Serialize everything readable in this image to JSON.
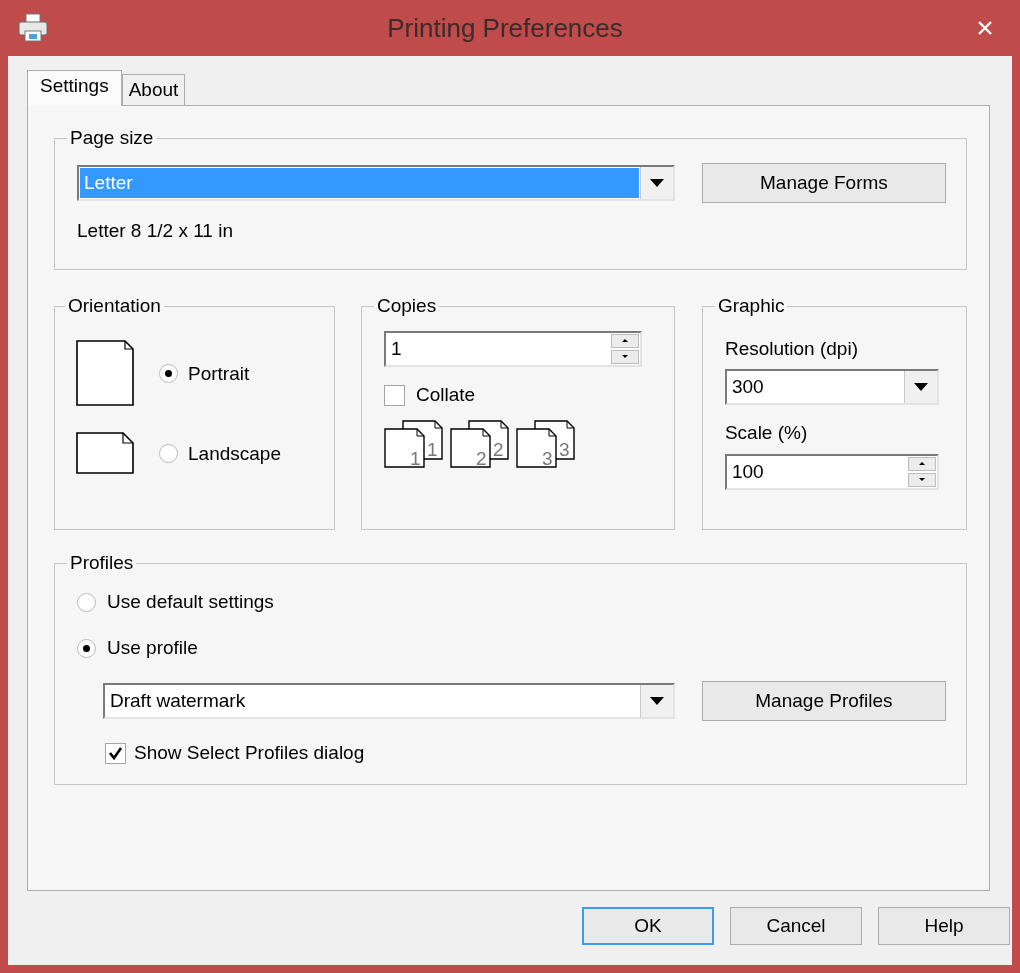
{
  "window": {
    "title": "Printing Preferences"
  },
  "tabs": [
    {
      "label": "Settings",
      "selected": true
    },
    {
      "label": "About",
      "selected": false
    }
  ],
  "page_size": {
    "title": "Page size",
    "dropdown": {
      "value": "Letter",
      "highlighted": true
    },
    "button": "Manage Forms",
    "description": "Letter 8 1/2 x 11 in"
  },
  "orientation": {
    "title": "Orientation",
    "options": [
      {
        "label": "Portrait",
        "selected": true,
        "kind": "portrait"
      },
      {
        "label": "Landscape",
        "selected": false,
        "kind": "landscape"
      }
    ]
  },
  "copies": {
    "title": "Copies",
    "value": "1",
    "collate": {
      "label": "Collate",
      "checked": false
    },
    "stacks": [
      {
        "front": "1",
        "back": "1"
      },
      {
        "front": "2",
        "back": "2"
      },
      {
        "front": "3",
        "back": "3"
      }
    ]
  },
  "graphic": {
    "title": "Graphic",
    "resolution": {
      "label": "Resolution (dpi)",
      "value": "300"
    },
    "scale": {
      "label": "Scale (%)",
      "value": "100"
    }
  },
  "profiles": {
    "title": "Profiles",
    "options": [
      {
        "label": "Use default settings",
        "selected": false
      },
      {
        "label": "Use profile",
        "selected": true
      }
    ],
    "dropdown": "Draft watermark",
    "button": "Manage Profiles",
    "show_dialog": {
      "label": "Show Select Profiles dialog",
      "checked": true
    }
  },
  "buttons": [
    {
      "label": "OK",
      "default": true
    },
    {
      "label": "Cancel",
      "default": false
    },
    {
      "label": "Help",
      "default": false
    }
  ]
}
